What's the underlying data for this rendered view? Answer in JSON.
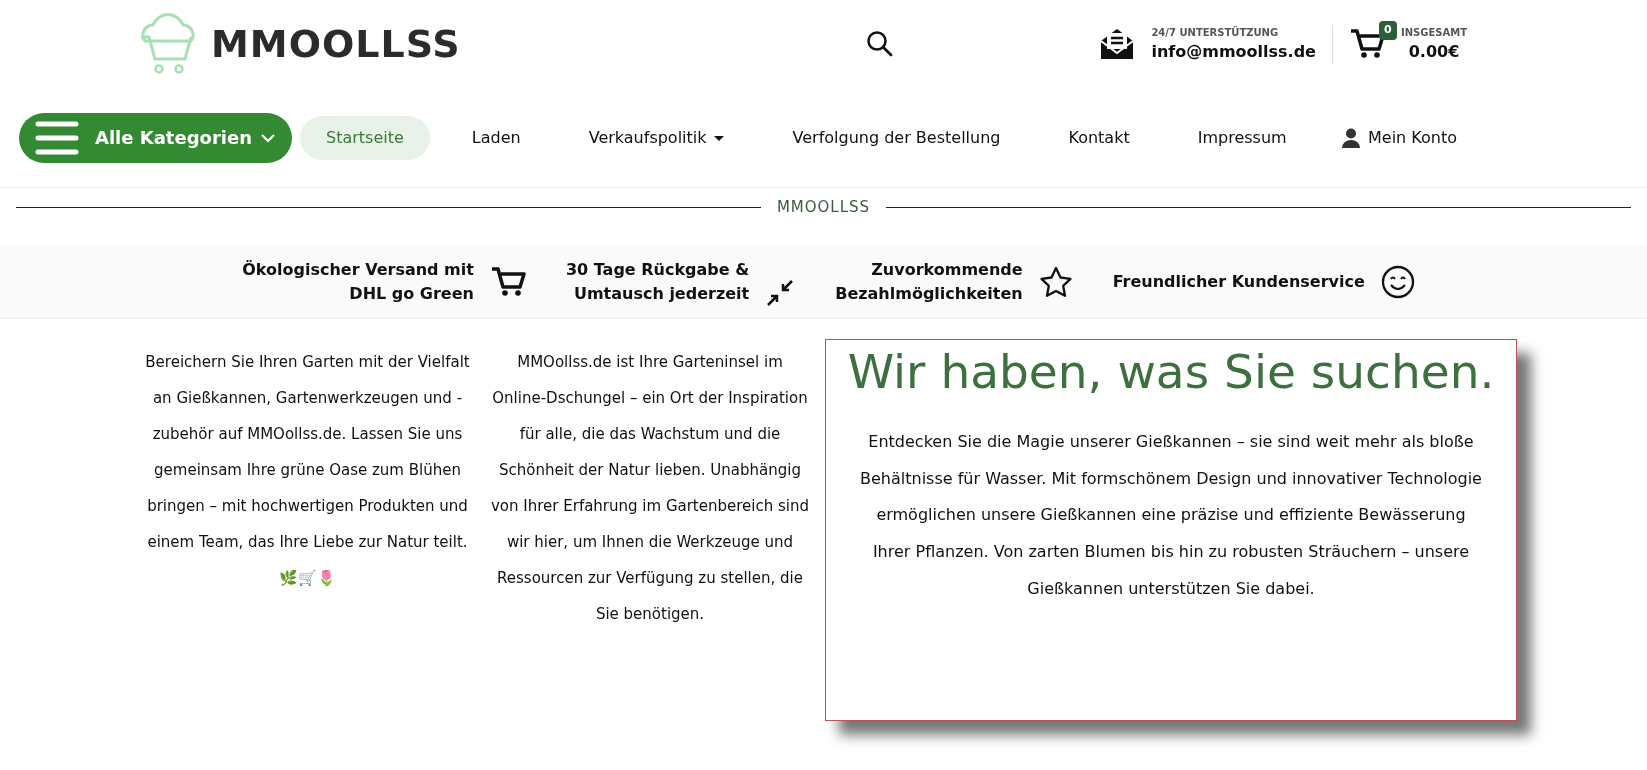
{
  "header": {
    "logo": "MMOOLLSS",
    "support": {
      "label": "24/7 UNTERSTÜTZUNG",
      "email": "info@mmoollss.de"
    },
    "cart": {
      "count": "0",
      "label": "INSGESAMT",
      "total": "0.00€"
    }
  },
  "nav": {
    "categories": "Alle Kategorien",
    "items": [
      {
        "label": "Startseite",
        "selected": true,
        "dropdown": false
      },
      {
        "label": "Laden",
        "selected": false,
        "dropdown": false
      },
      {
        "label": "Verkaufspolitik",
        "selected": false,
        "dropdown": true
      },
      {
        "label": "Verfolgung der Bestellung",
        "selected": false,
        "dropdown": false
      },
      {
        "label": "Kontakt",
        "selected": false,
        "dropdown": false
      },
      {
        "label": "Impressum",
        "selected": false,
        "dropdown": false
      }
    ],
    "account": "Mein Konto"
  },
  "separator": "MMOOLLSS",
  "features": [
    {
      "kind": "cart",
      "lines": [
        "Ökologischer Versand mit",
        "DHL go Green"
      ]
    },
    {
      "kind": "arrows",
      "lines": [
        "30 Tage Rückgabe &",
        "Umtausch jederzeit"
      ]
    },
    {
      "kind": "star",
      "lines": [
        "Zuvorkommende",
        "Bezahlmöglichkeiten"
      ]
    },
    {
      "kind": "smile",
      "lines": [
        "Freundlicher Kundenservice"
      ]
    }
  ],
  "columns": [
    "Bereichern Sie Ihren Garten mit der Vielfalt an Gießkannen, Gartenwerkzeugen und -zubehör auf MMOollss.de. Lassen Sie uns gemeinsam Ihre grüne Oase zum Blühen bringen – mit hochwertigen Produkten und einem Team, das Ihre Liebe zur Natur teilt. 🌿🛒🌷",
    "MMOollss.de ist Ihre Garteninsel im Online-Dschungel – ein Ort der Inspiration für alle, die das Wachstum und die Schönheit der Natur lieben. Unabhängig von Ihrer Erfahrung im Gartenbereich sind wir hier, um Ihnen die Werkzeuge und Ressourcen zur Verfügung zu stellen, die Sie benötigen."
  ],
  "card": {
    "title": "Wir haben, was Sie suchen.",
    "text": "Entdecken Sie die Magie unserer Gießkannen – sie sind weit mehr als bloße Behältnisse für Wasser. Mit formschönem Design und innovativer Technologie ermöglichen unsere Gießkannen eine präzise und effiziente Bewässerung Ihrer Pflanzen. Von zarten Blumen bis hin zu robusten Sträuchern – unsere Gießkannen unterstützen Sie dabei."
  }
}
